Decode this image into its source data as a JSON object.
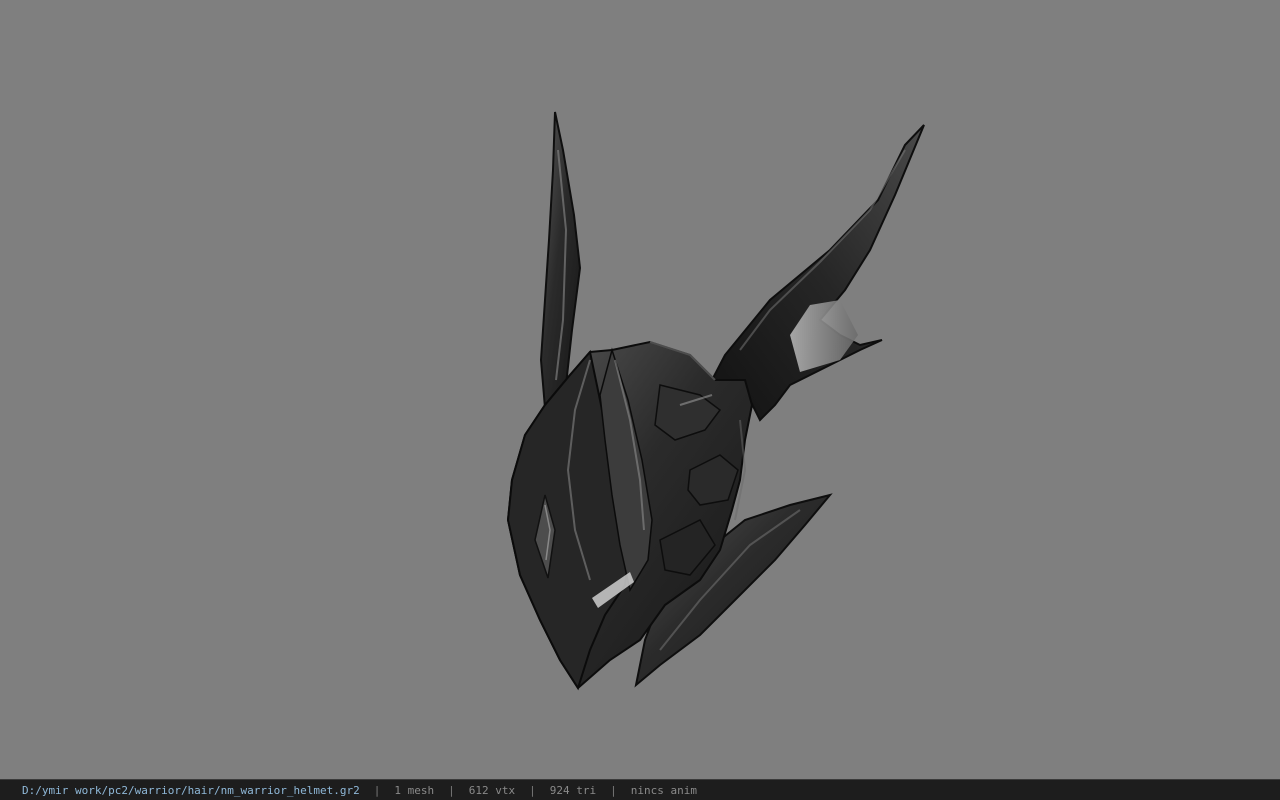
{
  "viewer": {
    "background_color": "#7f7f7f",
    "model_name": "warrior helmet"
  },
  "status_bar": {
    "file_path": "D:/ymir work/pc2/warrior/hair/nm_warrior_helmet.gr2",
    "separator": "|",
    "mesh_count": "1 mesh",
    "vertex_count": "612 vtx",
    "triangle_count": "924 tri",
    "anim_status": "nincs anim"
  }
}
